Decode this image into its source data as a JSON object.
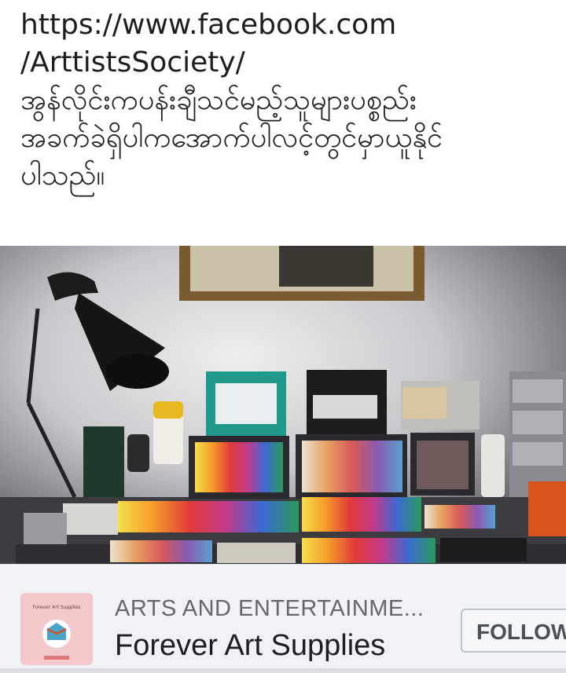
{
  "post": {
    "lines": [
      "https://www.facebook.com",
      "/ArttistsSociety/",
      "အွန်လိုင်းကပန်းချီသင်မည့်သူများပစ္စည်း",
      "အခက်ခဲရှိပါကအောက်ပါလင့်တွင်မှာယူနိုင်",
      "ပါသည်။"
    ]
  },
  "link_card": {
    "category": "ARTS AND ENTERTAINME...",
    "page_name": "Forever Art Supplies",
    "follow_label": "FOLLOW",
    "logo_text": "Forever Art Supplies"
  },
  "colors": {
    "card_background": "#f0f2f5",
    "logo_background": "#f4c9cc",
    "text_primary": "#1c1e21",
    "text_secondary": "#65676b"
  }
}
